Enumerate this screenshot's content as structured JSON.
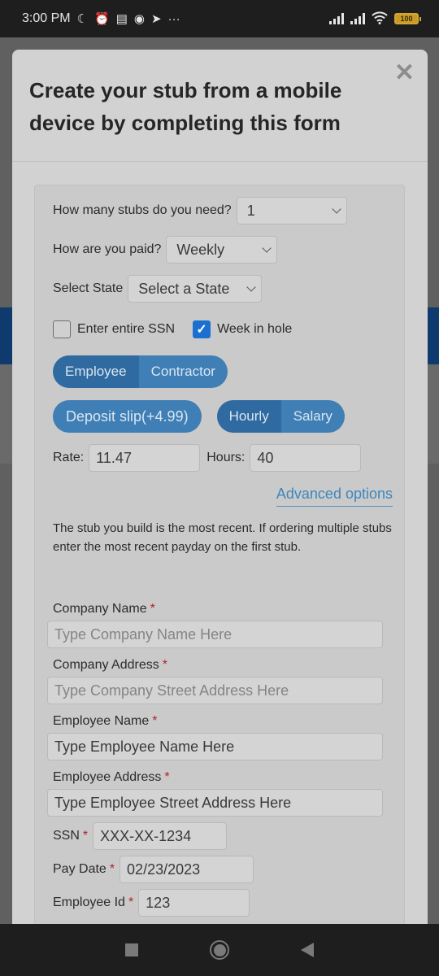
{
  "status_bar": {
    "time": "3:00 PM",
    "icons": [
      "moon-icon",
      "alarm-icon",
      "notes-icon",
      "messenger-icon",
      "arrow-app-icon",
      "more-dots-icon"
    ],
    "battery": "100"
  },
  "modal": {
    "title": "Create your stub from a mobile device by completing this form",
    "close_symbol": "✕"
  },
  "form": {
    "stubs_label": "How many stubs do you need?",
    "stubs_value": "1",
    "paid_label": "How are you paid?",
    "paid_value": "Weekly",
    "state_label": "Select State",
    "state_value": "Select a State",
    "ssn_checkbox_label": "Enter entire SSN",
    "ssn_checkbox_checked": false,
    "week_checkbox_label": "Week in hole",
    "week_checkbox_checked": true,
    "worker_type": {
      "options": [
        "Employee",
        "Contractor"
      ],
      "selected": "Employee"
    },
    "deposit_slip_label": "Deposit slip(+4.99)",
    "pay_type": {
      "options": [
        "Hourly",
        "Salary"
      ],
      "selected": "Hourly"
    },
    "rate_label": "Rate:",
    "rate_value": "11.47",
    "hours_label": "Hours:",
    "hours_value": "40",
    "advanced_link": "Advanced options",
    "note": "The stub you build is the most recent. If ordering multiple stubs enter the most recent payday on the first stub.",
    "required_mark": "*",
    "company_name_label": "Company Name",
    "company_name_placeholder": "Type Company Name Here",
    "company_address_label": "Company Address",
    "company_address_placeholder": "Type Company Street Address Here",
    "employee_name_label": "Employee Name",
    "employee_name_value": "Type Employee Name Here",
    "employee_address_label": "Employee Address",
    "employee_address_value": "Type Employee Street Address Here",
    "ssn_label": "SSN",
    "ssn_value": "XXX-XX-1234",
    "pay_date_label": "Pay Date",
    "pay_date_value": "02/23/2023",
    "employee_id_label": "Employee Id",
    "employee_id_value": "123"
  },
  "colors": {
    "accent_blue": "#3f7fb5",
    "accent_blue_active": "#2f6aa0",
    "checkbox_blue": "#1a6fd1",
    "required_red": "#b3242a",
    "link_blue": "#3f86bd"
  }
}
